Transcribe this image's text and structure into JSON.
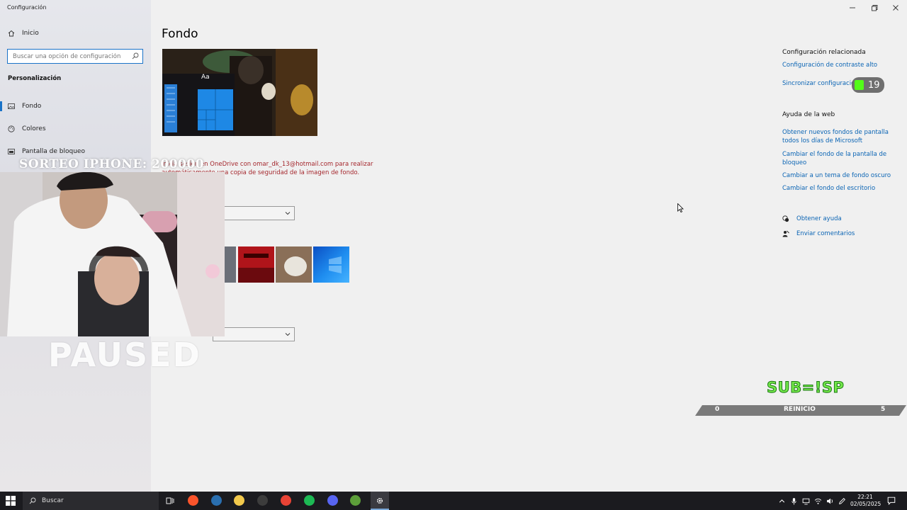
{
  "window": {
    "title": "Configuración"
  },
  "sidebar": {
    "home_label": "Inicio",
    "search_placeholder": "Buscar una opción de configuración",
    "section_title": "Personalización",
    "items": [
      {
        "label": "Fondo",
        "icon": "image-icon",
        "active": true
      },
      {
        "label": "Colores",
        "icon": "palette-icon"
      },
      {
        "label": "Pantalla de bloqueo",
        "icon": "lock-screen-icon"
      }
    ]
  },
  "main": {
    "title": "Fondo",
    "preview_tile_text": "Aa",
    "sync_notice": "Inicia sesión en OneDrive con omar_dk_13@hotmail.com para realizar automáticamente una copia de seguridad de la imagen de fondo."
  },
  "related": {
    "title": "Configuración relacionada",
    "links": [
      "Configuración de contraste alto",
      "Sincronizar configuración"
    ]
  },
  "web_help": {
    "title": "Ayuda de la web",
    "links": [
      "Obtener nuevos fondos de pantalla todos los días de Microsoft",
      "Cambiar el fondo de la pantalla de bloqueo",
      "Cambiar a un tema de fondo oscuro",
      "Cambiar el fondo del escritorio"
    ]
  },
  "help": {
    "get_help": "Obtener ayuda",
    "feedback": "Enviar comentarios"
  },
  "overlay": {
    "giveaway": "SORTEO IPHONE: 200000",
    "paused": "PAUSED",
    "sub_count": "19",
    "sub_goal": "SUB=!SP",
    "progress": {
      "start": "0",
      "label": "REINICIO",
      "end": "5",
      "fraction": 0.0
    }
  },
  "taskbar": {
    "search_label": "Buscar",
    "time": "22:21",
    "date": "02/05/2025",
    "apps": [
      {
        "icon": "task-view-icon",
        "color": "#1b1b1f"
      },
      {
        "icon": "brave-icon",
        "color": "#fb542b"
      },
      {
        "icon": "steam-icon",
        "color": "#2a6fb0"
      },
      {
        "icon": "folder-icon",
        "color": "#f2c94c"
      },
      {
        "icon": "obs-icon",
        "color": "#3c3c3c"
      },
      {
        "icon": "chrome-icon",
        "color": "#e84335"
      },
      {
        "icon": "spotify-icon",
        "color": "#1db954"
      },
      {
        "icon": "discord-icon",
        "color": "#5865f2"
      },
      {
        "icon": "minecraft-icon",
        "color": "#5d9e3a"
      },
      {
        "icon": "settings-icon",
        "color": "#3a3a40"
      }
    ]
  },
  "colors": {
    "accent": "#1a73c8",
    "link": "#0a64b4",
    "warning": "#a4262c",
    "kick_green": "#53fc18"
  }
}
